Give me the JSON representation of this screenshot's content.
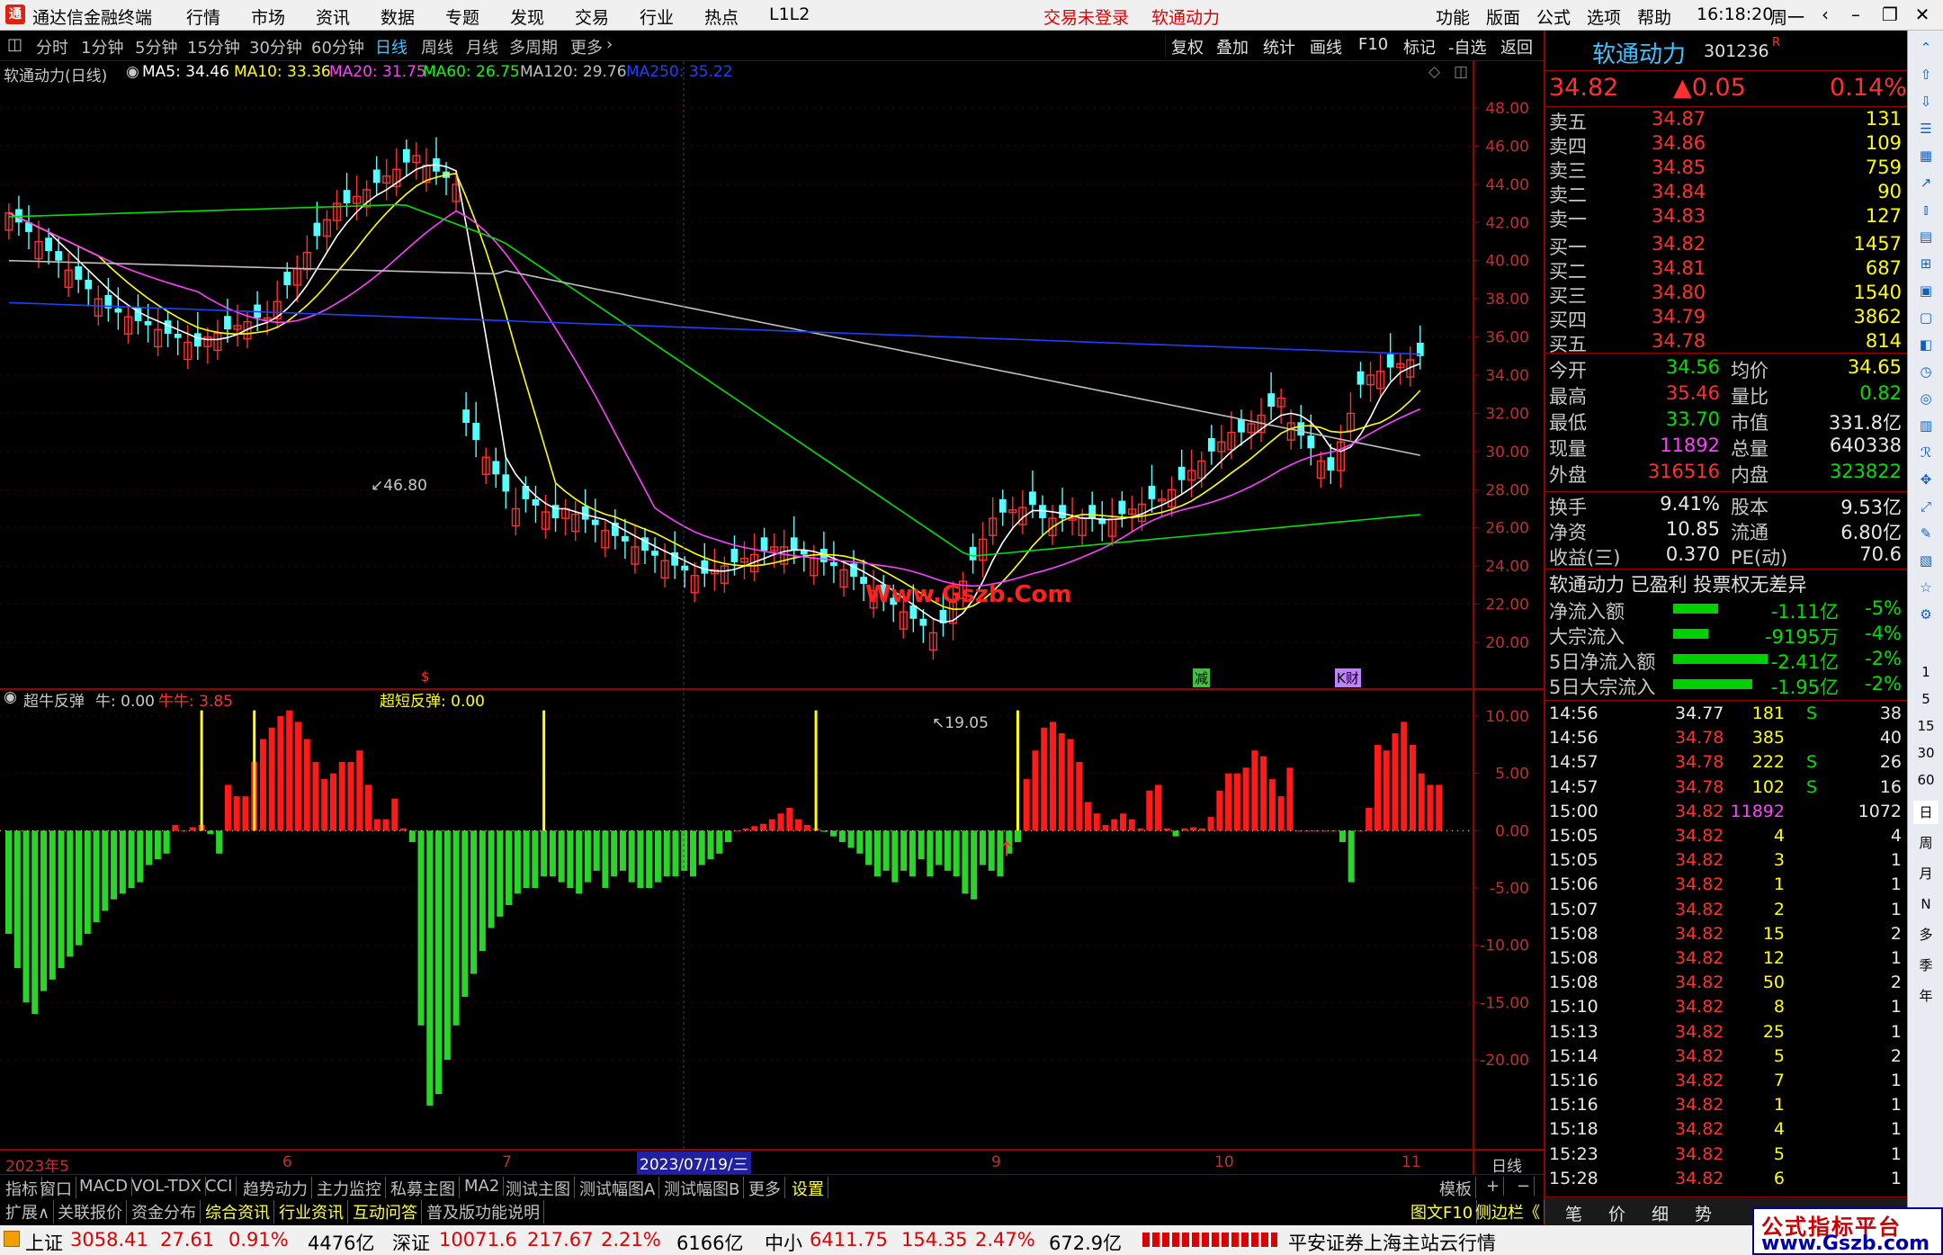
{
  "menubar": {
    "app_title": "通达信金融终端",
    "menus": [
      "行情",
      "市场",
      "资讯",
      "数据",
      "专题",
      "发现",
      "交易",
      "行业",
      "热点",
      "L1L2"
    ],
    "login_status": "交易未登录",
    "stock_name": "软通动力",
    "right_menus": [
      "功能",
      "版面",
      "公式",
      "选项",
      "帮助"
    ],
    "time": "16:18:20",
    "weekday": "周一"
  },
  "toolbar": {
    "periods": [
      "分时",
      "1分钟",
      "5分钟",
      "15分钟",
      "30分钟",
      "60分钟",
      "日线",
      "周线",
      "月线",
      "多周期",
      "更多"
    ],
    "active_period": "日线",
    "tools": [
      "复权",
      "叠加",
      "统计",
      "画线",
      "F10",
      "标记",
      "-自选",
      "返回"
    ]
  },
  "main_chart": {
    "title": "软通动力(日线)",
    "ma_labels": [
      {
        "text": "MA5: 34.46",
        "color": "#ffffff"
      },
      {
        "text": "MA10: 33.36",
        "color": "#ffff00"
      },
      {
        "text": "MA20: 31.75",
        "color": "#ff40ff"
      },
      {
        "text": "MA60: 26.75",
        "color": "#00ff00"
      },
      {
        "text": "MA120: 29.76",
        "color": "#c0c0c0"
      },
      {
        "text": "MA250: 35.22",
        "color": "#2040ff"
      }
    ],
    "high_label": "46.80",
    "low_label": "19.05",
    "watermark": "Www.Gszb.Com",
    "event_markers": [
      "$",
      "减",
      "K财"
    ],
    "y_ticks": [
      "48.00",
      "46.00",
      "44.00",
      "42.00",
      "40.00",
      "38.00",
      "36.00",
      "34.00",
      "32.00",
      "30.00",
      "28.00",
      "26.00",
      "24.00",
      "22.00",
      "20.00"
    ]
  },
  "indicator": {
    "title": "超牛反弹",
    "label1": "牛: 0.00",
    "label2": "牛牛: 3.85",
    "label3": "超短反弹: 0.00",
    "y_ticks": [
      "10.00",
      "5.00",
      "0.00",
      "-5.00",
      "-10.00",
      "-15.00",
      "-20.00"
    ]
  },
  "xaxis": {
    "labels": [
      "2023年5",
      "6",
      "7",
      "9",
      "10",
      "11"
    ],
    "highlight": "2023/07/19/三",
    "period_label": "日线"
  },
  "chart_data": {
    "type": "bar",
    "title": "超牛反弹",
    "ylim": [
      -22,
      12
    ],
    "values": [
      -9,
      -12,
      -15,
      -16,
      -14,
      -13,
      -12,
      -11,
      -10,
      -9,
      -8,
      -7,
      -6,
      -5.5,
      -5,
      -4.5,
      -3,
      -2.5,
      -2,
      0.5,
      0,
      0.3,
      0.5,
      -0.3,
      -2,
      4,
      3,
      3,
      6,
      8,
      9,
      10,
      10.5,
      9.5,
      8,
      6,
      4.5,
      5,
      6,
      6,
      7,
      4,
      1,
      1,
      2.8,
      0.2,
      -1,
      -17,
      -24,
      -23,
      -20,
      -17,
      -14.5,
      -12.5,
      -10.5,
      -8.5,
      -7.5,
      -6.5,
      -5.5,
      -5,
      -5,
      -4,
      -4,
      -4.5,
      -5,
      -5.5,
      -4.5,
      -3.5,
      -5,
      -4,
      -3.5,
      -4.5,
      -5,
      -5,
      -4.5,
      -4,
      -4,
      -3.5,
      -4,
      -3,
      -2.5,
      -2,
      -1,
      0,
      0.2,
      0.4,
      0.6,
      1,
      1.5,
      2,
      1,
      0.5,
      0.2,
      -0.1,
      -0.5,
      -1,
      -1.5,
      -2,
      -3,
      -4,
      -3.5,
      -4.5,
      -3.5,
      -4,
      -2.5,
      -4,
      -3,
      -3.5,
      -4,
      -5.5,
      -6,
      -3,
      -3.5,
      -4,
      -2,
      -1,
      4.5,
      7,
      9,
      9.5,
      8.5,
      8,
      6,
      2.5,
      1.5,
      0.5,
      1,
      1.5,
      1,
      0.2,
      3.5,
      4,
      0.2,
      -0.5,
      0.2,
      0.3,
      0.2,
      1.2,
      3.5,
      5,
      5,
      5.5,
      7,
      6.5,
      4.5,
      3,
      5.5,
      0,
      0,
      0,
      0,
      0,
      -1,
      -4.5,
      0,
      2,
      7.5,
      7,
      8.5,
      9.5,
      7.5,
      5,
      4,
      4
    ]
  },
  "quote": {
    "name": "软通动力",
    "code": "301236",
    "flag": "R",
    "price": "34.82",
    "change": "▲0.05",
    "pct": "0.14%",
    "sells": [
      {
        "label": "卖五",
        "price": "34.87",
        "vol": "131"
      },
      {
        "label": "卖四",
        "price": "34.86",
        "vol": "109"
      },
      {
        "label": "卖三",
        "price": "34.85",
        "vol": "759"
      },
      {
        "label": "卖二",
        "price": "34.84",
        "vol": "90"
      },
      {
        "label": "卖一",
        "price": "34.83",
        "vol": "127"
      }
    ],
    "buys": [
      {
        "label": "买一",
        "price": "34.82",
        "vol": "1457"
      },
      {
        "label": "买二",
        "price": "34.81",
        "vol": "687"
      },
      {
        "label": "买三",
        "price": "34.80",
        "vol": "1540"
      },
      {
        "label": "买四",
        "price": "34.79",
        "vol": "3862"
      },
      {
        "label": "买五",
        "price": "34.78",
        "vol": "814"
      }
    ],
    "stats": [
      {
        "l1": "今开",
        "v1": "34.56",
        "c1": "green",
        "l2": "均价",
        "v2": "34.65",
        "c2": "yellow"
      },
      {
        "l1": "最高",
        "v1": "35.46",
        "c1": "red",
        "l2": "量比",
        "v2": "0.82",
        "c2": "green"
      },
      {
        "l1": "最低",
        "v1": "33.70",
        "c1": "green",
        "l2": "市值",
        "v2": "331.8亿",
        "c2": "white"
      },
      {
        "l1": "现量",
        "v1": "11892",
        "c1": "magenta",
        "l2": "总量",
        "v2": "640338",
        "c2": "white"
      },
      {
        "l1": "外盘",
        "v1": "316516",
        "c1": "red",
        "l2": "内盘",
        "v2": "323822",
        "c2": "green"
      }
    ],
    "stats2": [
      {
        "l1": "换手",
        "v1": "9.41%",
        "l2": "股本",
        "v2": "9.53亿"
      },
      {
        "l1": "净资",
        "v1": "10.85",
        "l2": "流通",
        "v2": "6.80亿"
      },
      {
        "l1": "收益(三)",
        "v1": "0.370",
        "l2": "PE(动)",
        "v2": "70.6"
      }
    ],
    "tag_line": "软通动力 已盈利 投票权无差异",
    "flows": [
      {
        "label": "净流入额",
        "value": "-1.11亿",
        "pct": "-5%",
        "bar": 0.45
      },
      {
        "label": "大宗流入",
        "value": "-9195万",
        "pct": "-4%",
        "bar": 0.35
      },
      {
        "label": "5日净流入额",
        "value": "-2.41亿",
        "pct": "-2%",
        "bar": 0.95
      },
      {
        "label": "5日大宗流入",
        "value": "-1.95亿",
        "pct": "-2%",
        "bar": 0.8
      }
    ],
    "ticks": [
      {
        "t": "14:56",
        "p": "34.77",
        "v": "181",
        "s": "S",
        "n": "38"
      },
      {
        "t": "14:56",
        "p": "34.78",
        "v": "385",
        "s": "",
        "n": "40"
      },
      {
        "t": "14:57",
        "p": "34.78",
        "v": "222",
        "s": "S",
        "n": "26"
      },
      {
        "t": "14:57",
        "p": "34.78",
        "v": "102",
        "s": "S",
        "n": "16"
      },
      {
        "t": "15:00",
        "p": "34.82",
        "v": "11892",
        "s": "",
        "n": "1072"
      },
      {
        "t": "15:05",
        "p": "34.82",
        "v": "4",
        "s": "",
        "n": "4"
      },
      {
        "t": "15:05",
        "p": "34.82",
        "v": "3",
        "s": "",
        "n": "1"
      },
      {
        "t": "15:06",
        "p": "34.82",
        "v": "1",
        "s": "",
        "n": "1"
      },
      {
        "t": "15:07",
        "p": "34.82",
        "v": "2",
        "s": "",
        "n": "1"
      },
      {
        "t": "15:08",
        "p": "34.82",
        "v": "15",
        "s": "",
        "n": "2"
      },
      {
        "t": "15:08",
        "p": "34.82",
        "v": "12",
        "s": "",
        "n": "1"
      },
      {
        "t": "15:08",
        "p": "34.82",
        "v": "50",
        "s": "",
        "n": "2"
      },
      {
        "t": "15:10",
        "p": "34.82",
        "v": "8",
        "s": "",
        "n": "1"
      },
      {
        "t": "15:13",
        "p": "34.82",
        "v": "25",
        "s": "",
        "n": "1"
      },
      {
        "t": "15:14",
        "p": "34.82",
        "v": "5",
        "s": "",
        "n": "2"
      },
      {
        "t": "15:16",
        "p": "34.82",
        "v": "7",
        "s": "",
        "n": "1"
      },
      {
        "t": "15:16",
        "p": "34.82",
        "v": "1",
        "s": "",
        "n": "1"
      },
      {
        "t": "15:18",
        "p": "34.82",
        "v": "4",
        "s": "",
        "n": "1"
      },
      {
        "t": "15:23",
        "p": "34.82",
        "v": "5",
        "s": "",
        "n": "1"
      },
      {
        "t": "15:28",
        "p": "34.82",
        "v": "6",
        "s": "",
        "n": "1"
      }
    ],
    "bottom_tabs": [
      "笔",
      "价",
      "细",
      "势"
    ]
  },
  "tabs_row1": [
    "指标",
    "窗口",
    "MACD",
    "VOL-TDX",
    "CCI",
    "趋势动力",
    "主力监控",
    "私募主图",
    "MA2",
    "测试主图",
    "测试幅图A",
    "测试幅图B",
    "更多",
    "设置"
  ],
  "tabs_row1_right": [
    "模板",
    "+",
    "−"
  ],
  "tabs_row2": [
    "扩展∧",
    "关联报价",
    "资金分布",
    "综合资讯",
    "行业资讯",
    "互动问答",
    "普及版功能说明"
  ],
  "tabs_row2_right": [
    "图文F10",
    "侧边栏《"
  ],
  "farright_items": [
    "1",
    "5",
    "15",
    "30",
    "60",
    "日",
    "周",
    "月",
    "N",
    "多",
    "季",
    "年"
  ],
  "statusbar": {
    "sh_label": "上证",
    "sh_val": "3058.41",
    "sh_chg": "27.61",
    "sh_pct": "0.91%",
    "sh_amt": "4476亿",
    "sz_label": "深证",
    "sz_val": "10071.6",
    "sz_chg": "217.67",
    "sz_pct": "2.21%",
    "sz_amt": "6166亿",
    "zx_label": "中小",
    "zx_val": "6411.75",
    "zx_chg": "154.35",
    "zx_pct": "2.47%",
    "zx_amt": "672.9亿",
    "broker": "平安证券上海主站云行情"
  },
  "watermark_site": {
    "line1": "公式指标平台",
    "line2": "www.Gszb.com"
  }
}
